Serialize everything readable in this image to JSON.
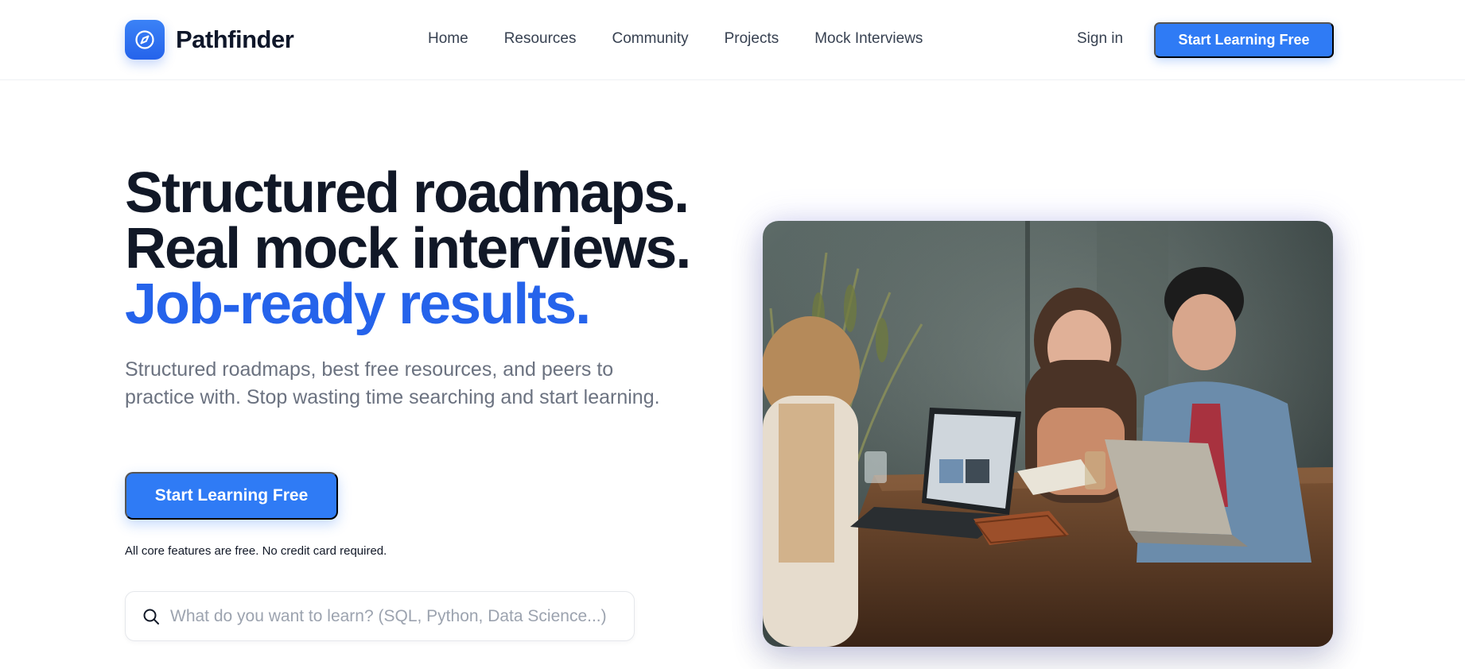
{
  "brand": {
    "name": "Pathfinder",
    "icon": "compass-icon",
    "accent": "#2f7bf5"
  },
  "nav": {
    "items": [
      {
        "label": "Home"
      },
      {
        "label": "Resources"
      },
      {
        "label": "Community"
      },
      {
        "label": "Projects"
      },
      {
        "label": "Mock Interviews"
      }
    ],
    "signin_label": "Sign in",
    "cta_label": "Start Learning Free"
  },
  "hero": {
    "title_line1": "Structured roadmaps.",
    "title_line2": "Real mock interviews.",
    "title_line3": "Job-ready results.",
    "subtitle": "Structured roadmaps, best free resources, and peers to practice with. Stop wasting time searching and start learning.",
    "cta_label": "Start Learning Free",
    "note": "All core features are free. No credit card required."
  },
  "search": {
    "placeholder": "What do you want to learn? (SQL, Python, Data Science...)",
    "icon": "search-icon"
  },
  "photo": {
    "alt": "Three people laughing around a table with laptops"
  }
}
